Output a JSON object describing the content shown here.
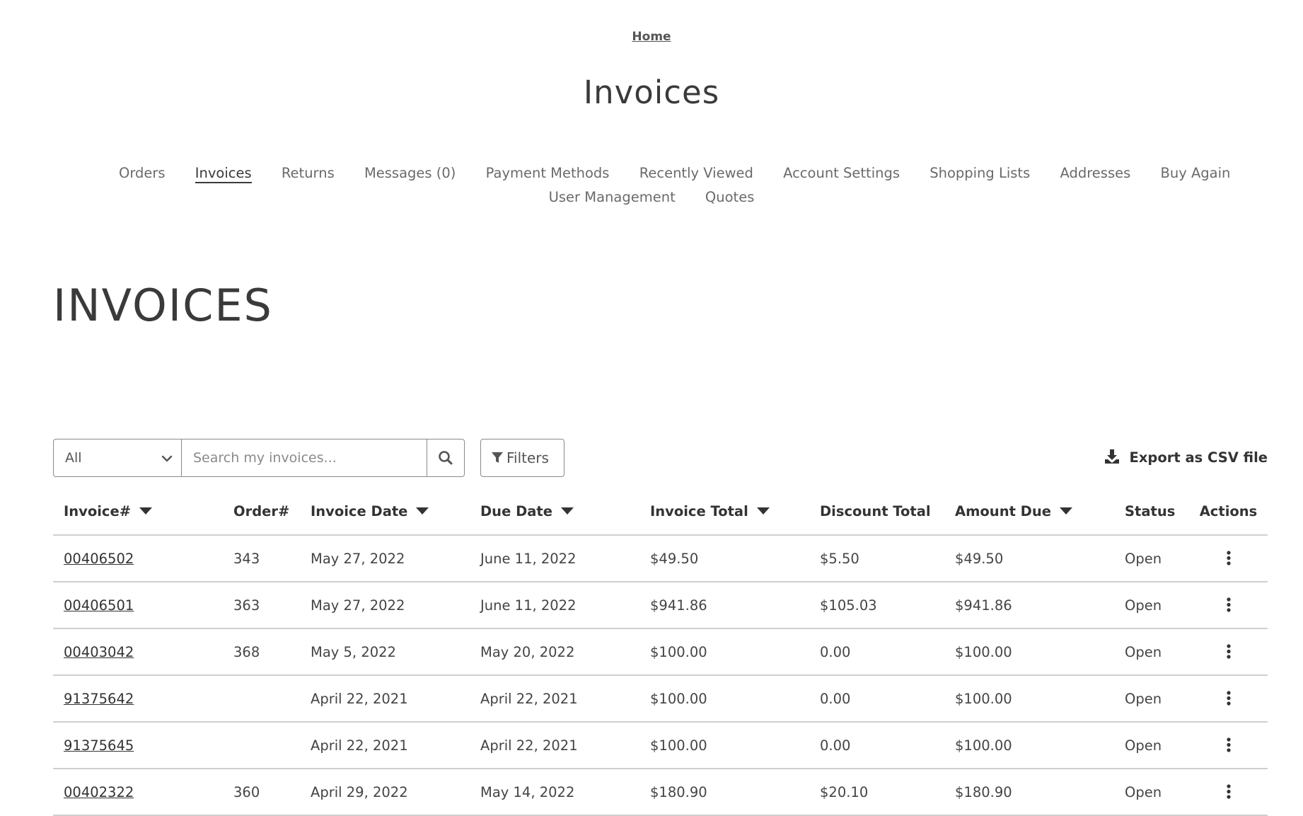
{
  "breadcrumb": {
    "home_label": "Home"
  },
  "page_title": "Invoices",
  "account_nav": {
    "row1": [
      "Orders",
      "Invoices",
      "Returns",
      "Messages (0)",
      "Payment Methods",
      "Recently Viewed",
      "Account Settings",
      "Shopping Lists",
      "Addresses",
      "Buy Again"
    ],
    "row2": [
      "User Management",
      "Quotes"
    ],
    "active": "Invoices"
  },
  "section_heading": "INVOICES",
  "toolbar": {
    "scope_selected": "All",
    "search_placeholder": "Search my invoices...",
    "filters_label": "Filters",
    "export_label": "Export as CSV file"
  },
  "table": {
    "columns": [
      "Invoice#",
      "Order#",
      "Invoice Date",
      "Due Date",
      "Invoice Total",
      "Discount Total",
      "Amount Due",
      "Status",
      "Actions"
    ],
    "rows": [
      [
        "00406502",
        "343",
        "May 27, 2022",
        "June 11, 2022",
        "$49.50",
        "$5.50",
        "$49.50",
        "Open"
      ],
      [
        "00406501",
        "363",
        "May 27, 2022",
        "June 11, 2022",
        "$941.86",
        "$105.03",
        "$941.86",
        "Open"
      ],
      [
        "00403042",
        "368",
        "May 5, 2022",
        "May 20, 2022",
        "$100.00",
        "0.00",
        "$100.00",
        "Open"
      ],
      [
        "91375642",
        "",
        "April 22, 2021",
        "April 22, 2021",
        "$100.00",
        "0.00",
        "$100.00",
        "Open"
      ],
      [
        "91375645",
        "",
        "April 22, 2021",
        "April 22, 2021",
        "$100.00",
        "0.00",
        "$100.00",
        "Open"
      ],
      [
        "00402322",
        "360",
        "April 29, 2022",
        "May 14, 2022",
        "$180.90",
        "$20.10",
        "$180.90",
        "Open"
      ]
    ]
  },
  "colors": {
    "text": "#333333",
    "muted": "#6a6a6a",
    "border": "#cfcfcf"
  }
}
